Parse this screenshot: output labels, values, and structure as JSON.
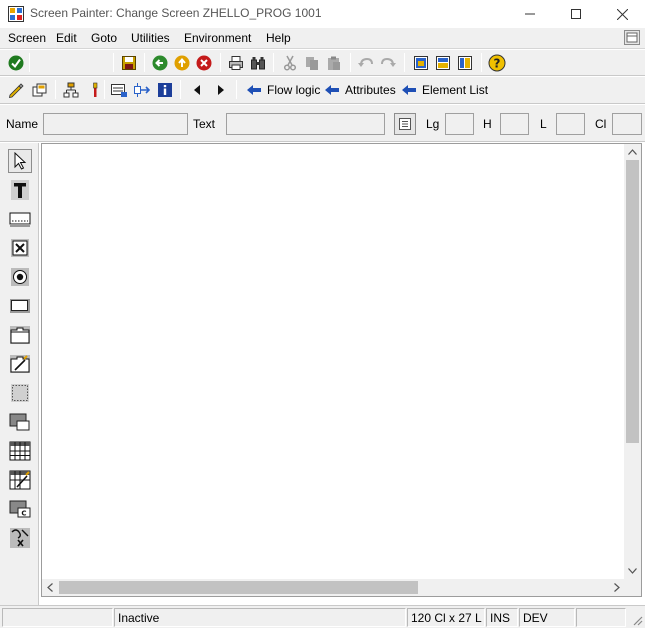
{
  "window": {
    "title": "Screen Painter:  Change Screen ZHELLO_PROG 1001",
    "controls": [
      "minimize-icon",
      "maximize-icon",
      "close-icon"
    ]
  },
  "menu": {
    "items": [
      "Screen",
      "Edit",
      "Goto",
      "Utilities",
      "Environment",
      "Help"
    ],
    "right_icon": "layout-icon"
  },
  "toolbar": {
    "standard_icons": [
      "enter-icon",
      "save-icon",
      "back-icon",
      "exit-icon",
      "cancel-icon",
      "print-icon",
      "find-icon",
      "cut-icon",
      "copy-icon",
      "paste-icon",
      "undo-icon",
      "redo-icon",
      "layout-1-icon",
      "layout-2-icon",
      "layout-3-icon",
      "help-icon"
    ],
    "app_icons": [
      "edit-element-icon",
      "other-screen-icon",
      "hierarchy-icon",
      "paint-icon",
      "dict-fields-icon",
      "move-icon",
      "info-icon",
      "previous-icon",
      "next-icon"
    ],
    "links": [
      {
        "label": "Flow logic"
      },
      {
        "label": "Attributes"
      },
      {
        "label": "Element List"
      }
    ]
  },
  "attributes": {
    "name_label": "Name",
    "name_value": "",
    "text_label": "Text",
    "text_value": "",
    "lg_label": "Lg",
    "lg_value": "",
    "h_label": "H",
    "h_value": "",
    "l_label": "L",
    "l_value": "",
    "cl_label": "Cl",
    "cl_value": ""
  },
  "palette": {
    "tools": [
      "select-pointer-icon",
      "text-field-icon",
      "input-field-icon",
      "checkbox-icon",
      "radio-button-icon",
      "pushbutton-icon",
      "tabstrip-icon",
      "tabstrip-wizard-icon",
      "box-icon",
      "subscreen-icon",
      "table-control-icon",
      "table-control-wizard-icon",
      "custom-control-icon",
      "status-icon-tool-icon"
    ],
    "active": 0
  },
  "status": {
    "message": "",
    "state": "Inactive",
    "size": "120 Cl x 27 L",
    "mode": "INS",
    "system": "DEV",
    "extra": ""
  },
  "colors": {
    "chrome": "#f0f0f0",
    "canvas": "#ffffff",
    "link_arrow": "#1e4fb5",
    "scroll_thumb": "#c2c2c2"
  }
}
